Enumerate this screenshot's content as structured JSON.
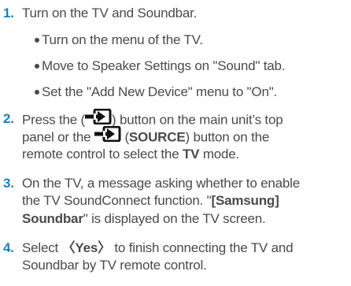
{
  "steps": [
    {
      "number": "1.",
      "text": "Turn on the TV and Soundbar.",
      "bullets": [
        "Turn on the menu of the TV.",
        "Move to Speaker Settings on \"Sound\" tab.",
        "Set the \"Add New Device\" menu to \"On\"."
      ]
    },
    {
      "number": "2.",
      "line1_a": "Press the (",
      "line1_b": ") button on the main unit’s top",
      "line2_a": "panel or the",
      "line2_b": "(",
      "line2_bold": "SOURCE",
      "line2_c": ") button on the",
      "line3_a": "remote control to select the ",
      "line3_bold": "TV",
      "line3_b": " mode.",
      "icon": "source-input-icon"
    },
    {
      "number": "3.",
      "line1": "On the TV, a message asking whether to enable",
      "line2_a": "the TV SoundConnect function. \"",
      "line2_bold": "[Samsung]",
      "line3_bold": "Soundbar",
      "line3_b": "\" is displayed on the TV screen."
    },
    {
      "number": "4.",
      "line1_a": "Select ",
      "line1_bold": "〈Yes〉",
      "line1_b": " to finish connecting the TV and",
      "line2": "Soundbar by TV remote control."
    }
  ]
}
